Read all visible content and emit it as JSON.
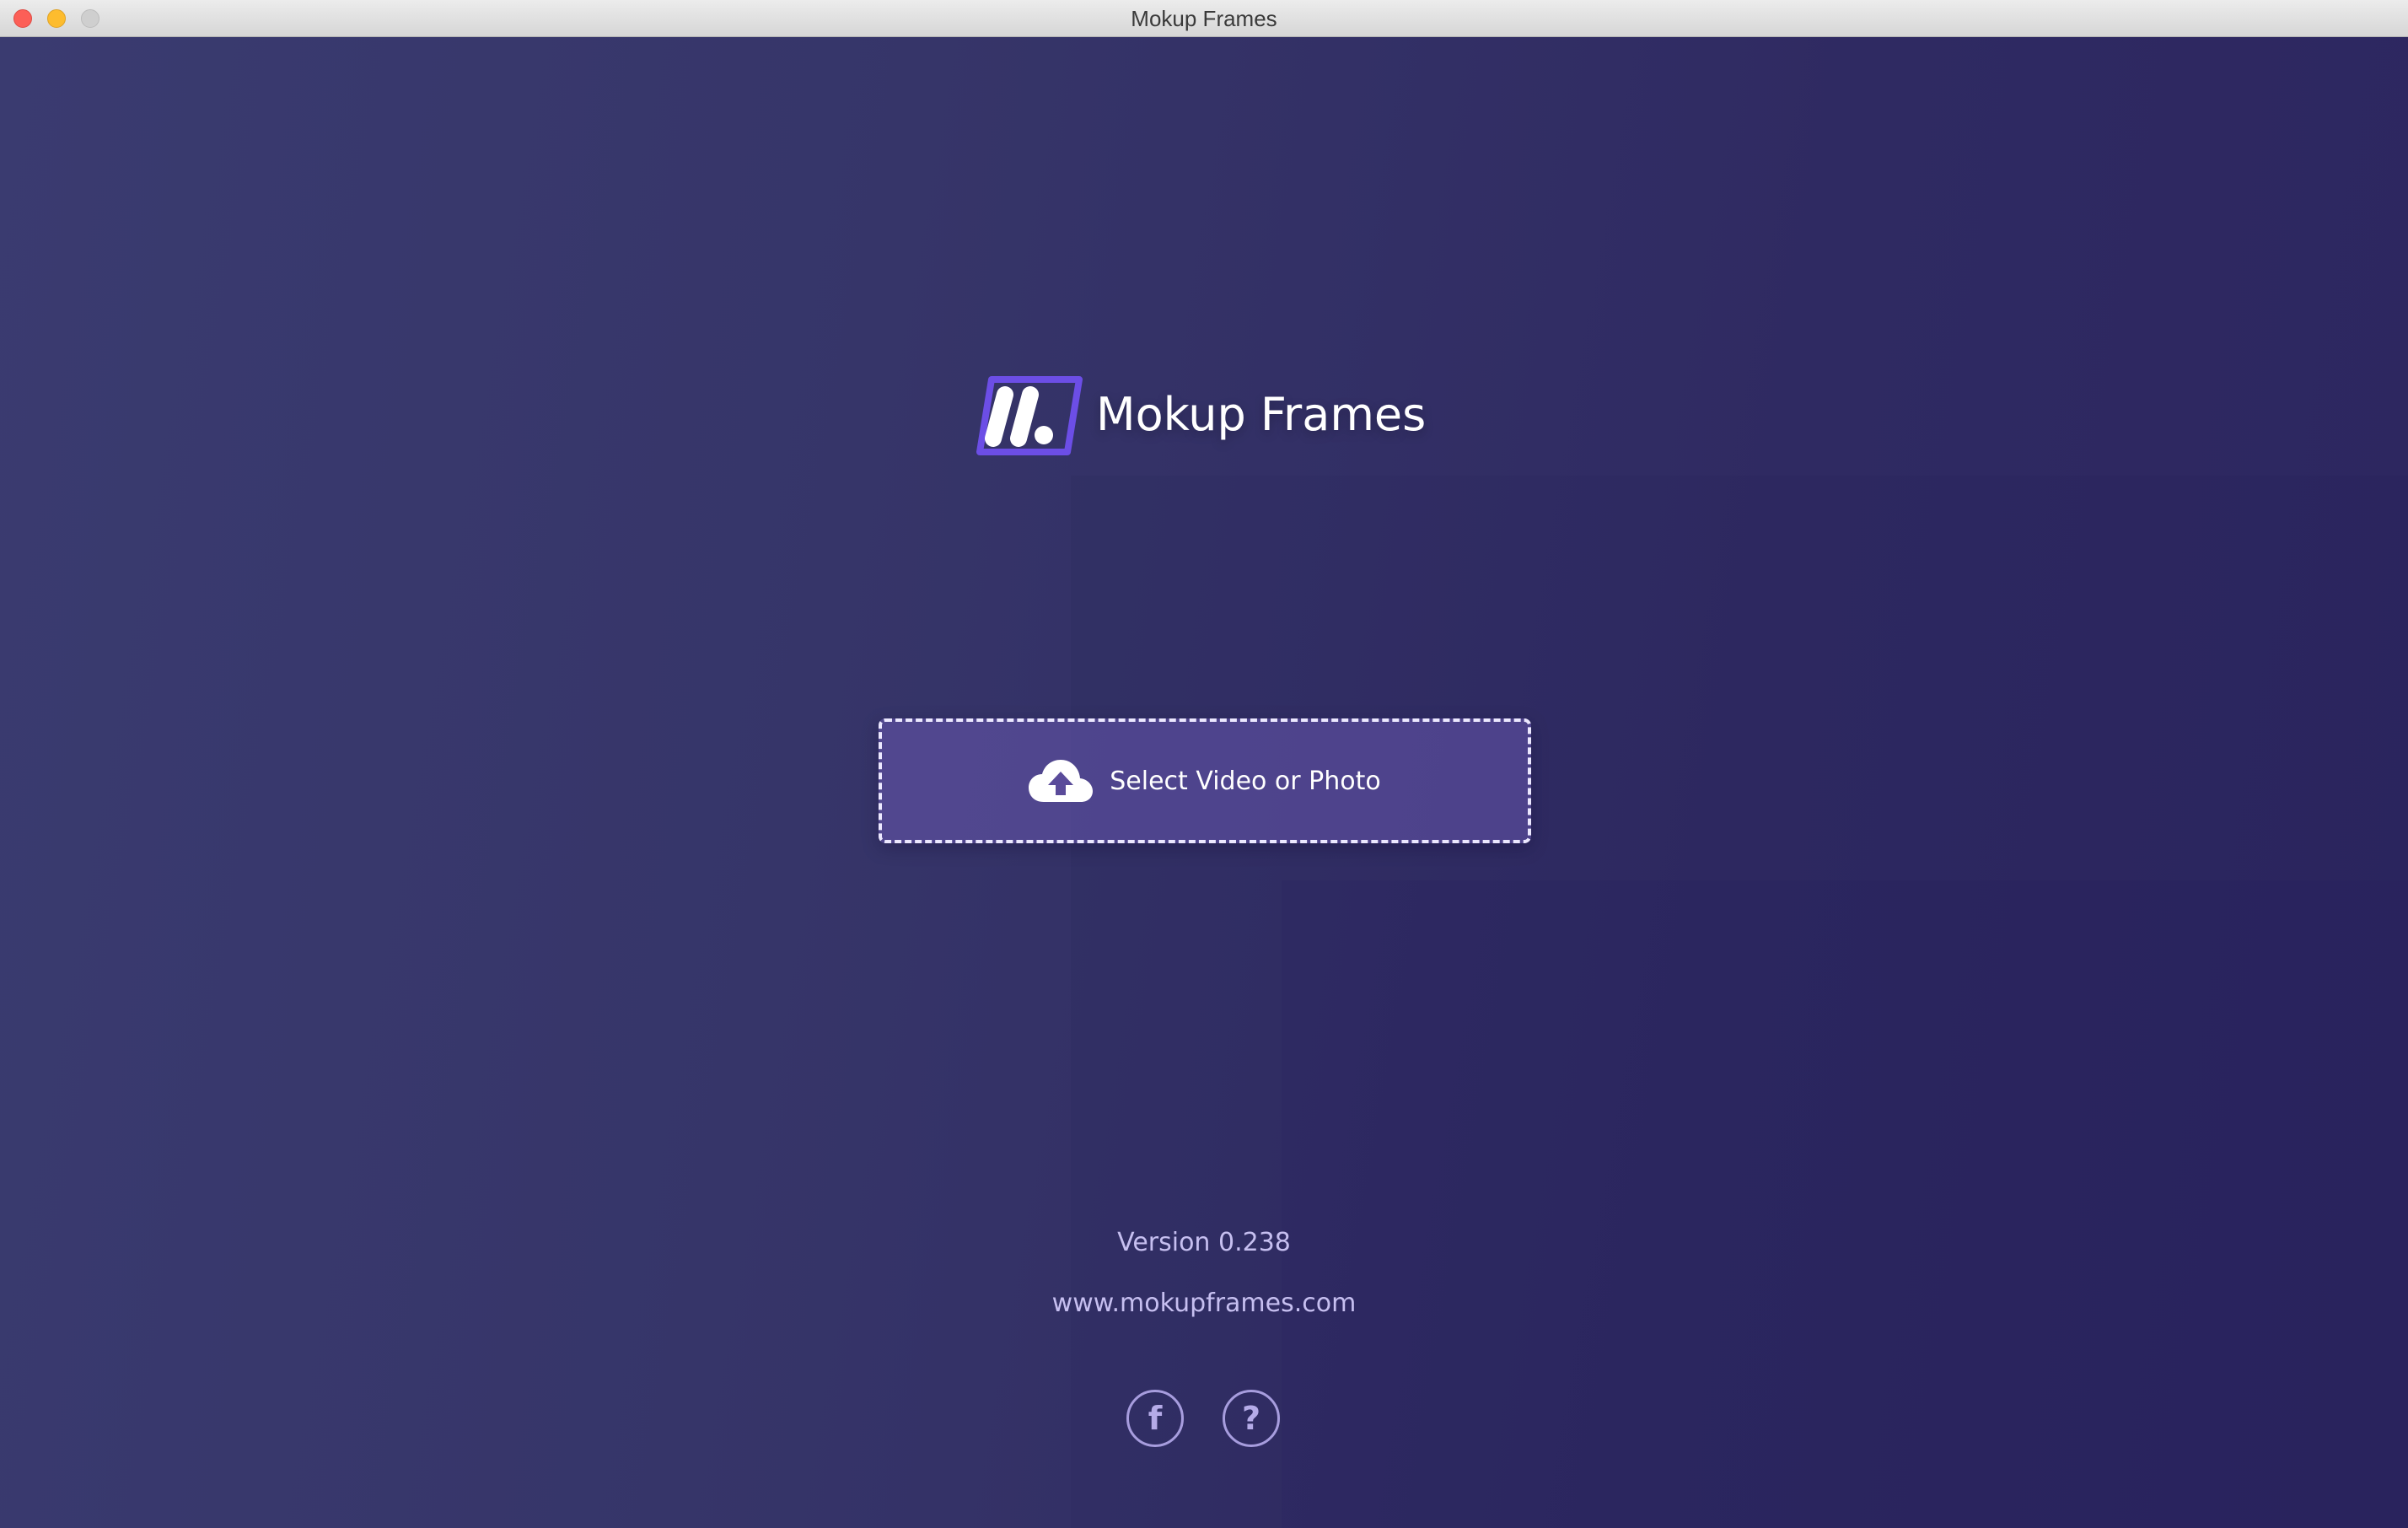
{
  "window": {
    "title": "Mokup Frames"
  },
  "brand": {
    "name": "Mokup Frames",
    "logo_icon": "mokup-frames-logo"
  },
  "upload": {
    "label": "Select Video or Photo",
    "icon": "cloud-upload-icon"
  },
  "footer": {
    "version": "Version 0.238",
    "website": "www.mokupframes.com",
    "facebook_glyph": "f",
    "help_glyph": "?"
  },
  "colors": {
    "background": "#342f66",
    "accent": "#6c4ee6",
    "text_muted": "#c6bff0"
  }
}
